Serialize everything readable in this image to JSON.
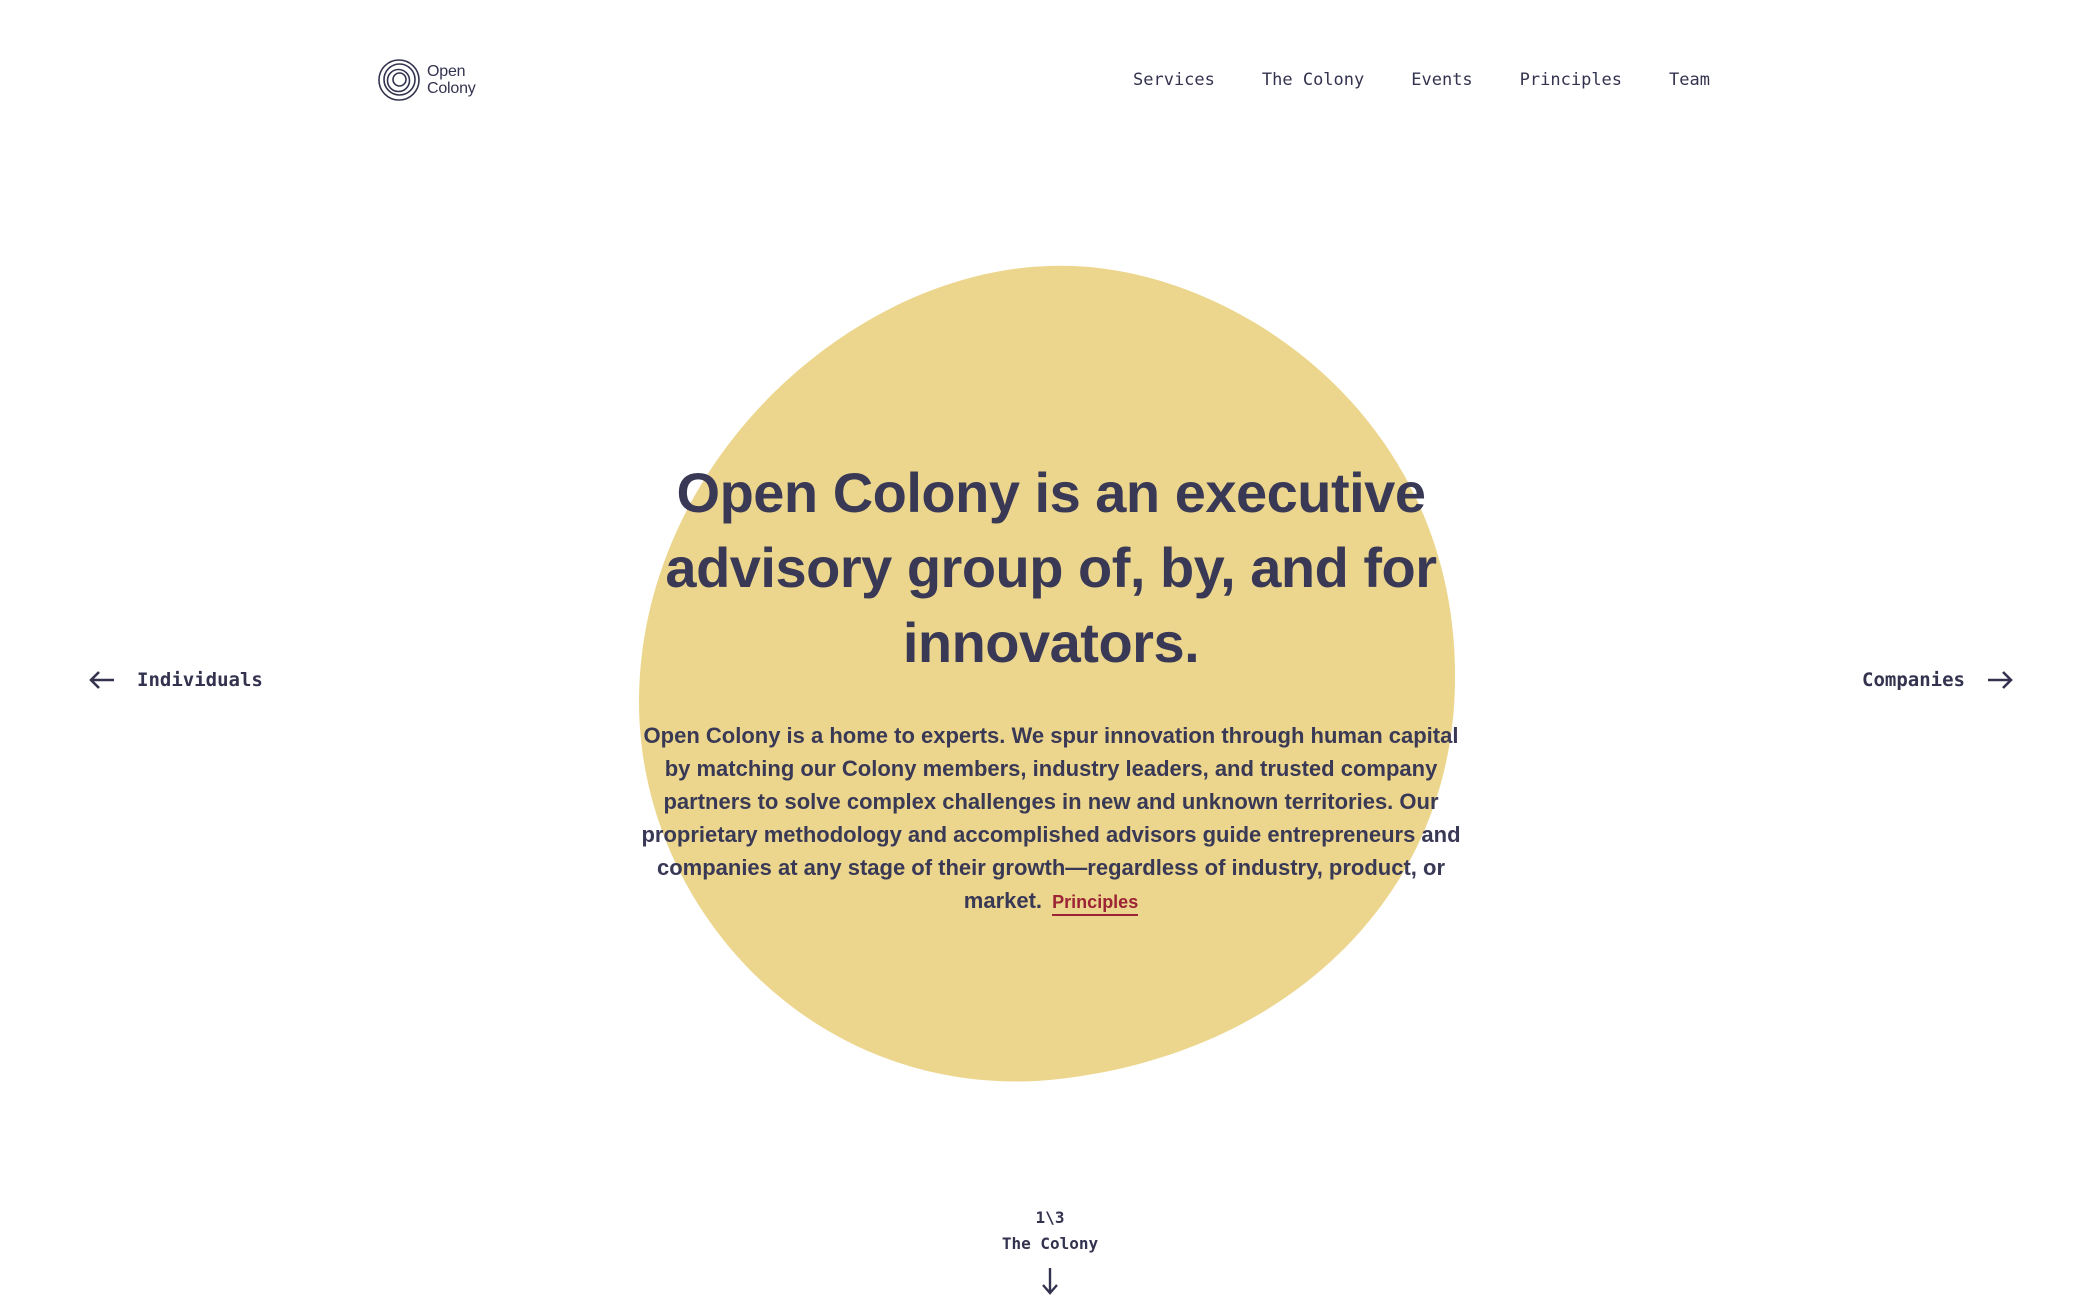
{
  "logo": {
    "line1": "Open",
    "line2": "Colony",
    "icon": "concentric-spiral-icon"
  },
  "nav": {
    "items": [
      {
        "label": "Services"
      },
      {
        "label": "The Colony"
      },
      {
        "label": "Events"
      },
      {
        "label": "Principles"
      },
      {
        "label": "Team"
      }
    ]
  },
  "hero": {
    "headline": "Open Colony is an executive advisory group of, by, and for innovators.",
    "body": "Open Colony is a home to experts. We spur innovation through human capital by matching our Colony members, industry leaders, and trusted company partners to solve complex challenges in new and unknown territories. Our proprietary methodology and accomplished advisors guide entrepreneurs and companies at any stage of their growth—regardless of industry, product, or market.",
    "link_label": "Principles"
  },
  "side": {
    "left_label": "Individuals",
    "left_icon": "arrow-left-icon",
    "right_label": "Companies",
    "right_icon": "arrow-right-icon"
  },
  "pager": {
    "position": "1\\3",
    "section": "The Colony",
    "icon": "arrow-down-icon"
  },
  "colors": {
    "background": "#ffffff",
    "blob": "#ecd68d",
    "text": "#393956",
    "link": "#9b2335"
  }
}
